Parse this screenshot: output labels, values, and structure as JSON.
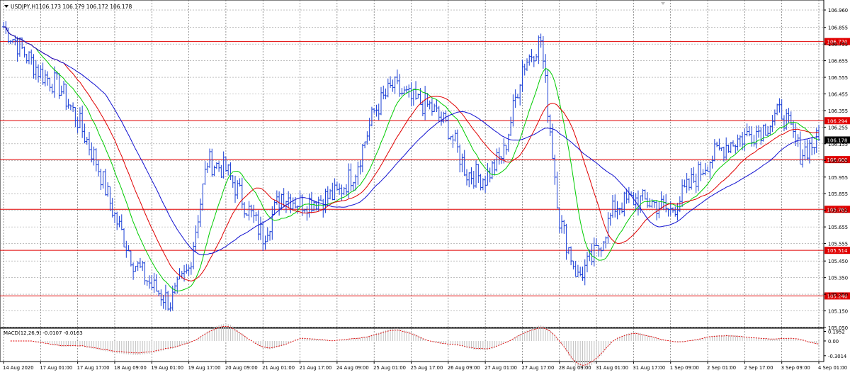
{
  "header": {
    "symbol_label": "USDJPY,H1",
    "ohlc": "106.173 106.179 106.172 106.178"
  },
  "colors": {
    "candles": "#1a3fd6",
    "ma_fast": "#00cc00",
    "ma_mid": "#e00000",
    "ma_slow": "#1010d0",
    "level_line": "#e00000",
    "grid": "#000000",
    "macd_hist": "#c0c0c0",
    "macd_signal": "#e00000"
  },
  "chart_data": [
    {
      "type": "candlestick",
      "title": "USDJPY,H1",
      "ylim": [
        105.05,
        107.02
      ],
      "y_ticks": [
        106.96,
        106.855,
        106.755,
        106.655,
        106.555,
        106.455,
        106.355,
        106.255,
        106.155,
        106.055,
        105.955,
        105.855,
        105.755,
        105.655,
        105.555,
        105.45,
        105.35,
        105.25,
        105.15,
        105.05
      ],
      "y_tick_labels": [
        "106.960",
        "106.855",
        "106.755",
        "106.655",
        "106.555",
        "106.455",
        "106.355",
        "106.255",
        "106.155",
        "106.055",
        "105.955",
        "105.855",
        "105.755",
        "105.655",
        "105.555",
        "105.450",
        "105.350",
        "105.250",
        "105.150",
        "105.050"
      ],
      "x_labels": [
        "14 Aug 2020",
        "17 Aug 01:00",
        "17 Aug 17:00",
        "18 Aug 09:00",
        "19 Aug 01:00",
        "19 Aug 17:00",
        "20 Aug 09:00",
        "21 Aug 01:00",
        "21 Aug 17:00",
        "24 Aug 09:00",
        "25 Aug 01:00",
        "25 Aug 17:00",
        "26 Aug 09:00",
        "27 Aug 01:00",
        "27 Aug 17:00",
        "28 Aug 09:00",
        "31 Aug 01:00",
        "31 Aug 17:00",
        "1 Sep 09:00",
        "2 Sep 01:00",
        "2 Sep 17:00",
        "3 Sep 09:00",
        "4 Sep 01:00"
      ],
      "x_label_positions": [
        0,
        2,
        4,
        6,
        8,
        10,
        12,
        14,
        16,
        18,
        20,
        22,
        24,
        26,
        28,
        30,
        32,
        34,
        36,
        38,
        40,
        42,
        44
      ],
      "x_count": 45,
      "grid": true,
      "levels": [
        {
          "value": 106.77,
          "label": "106.770"
        },
        {
          "value": 106.294,
          "label": "106.294"
        },
        {
          "value": 106.06,
          "label": "106.060"
        },
        {
          "value": 105.761,
          "label": "105.761"
        },
        {
          "value": 105.514,
          "label": "105.514"
        },
        {
          "value": 105.24,
          "label": "105.240"
        }
      ],
      "current_price": {
        "value": 106.178,
        "label": "106.178"
      },
      "price_path": [
        [
          0,
          106.86
        ],
        [
          1,
          106.72
        ],
        [
          2,
          106.58
        ],
        [
          3,
          106.5
        ],
        [
          4,
          106.3
        ],
        [
          5,
          106.05
        ],
        [
          6,
          105.72
        ],
        [
          7,
          105.45
        ],
        [
          8,
          105.3
        ],
        [
          9,
          105.2
        ],
        [
          10,
          105.4
        ],
        [
          11,
          106.05
        ],
        [
          12,
          106.0
        ],
        [
          13,
          105.8
        ],
        [
          14,
          105.6
        ],
        [
          15,
          105.85
        ],
        [
          16,
          105.8
        ],
        [
          17,
          105.82
        ],
        [
          18,
          105.85
        ],
        [
          19,
          106.0
        ],
        [
          20,
          106.35
        ],
        [
          21,
          106.5
        ],
        [
          22,
          106.42
        ],
        [
          23,
          106.38
        ],
        [
          24,
          106.25
        ],
        [
          25,
          105.98
        ],
        [
          26,
          105.95
        ],
        [
          27,
          106.1
        ],
        [
          28,
          106.62
        ],
        [
          29,
          106.78
        ],
        [
          30,
          105.7
        ],
        [
          31,
          105.35
        ],
        [
          32,
          105.5
        ],
        [
          33,
          105.78
        ],
        [
          34,
          105.82
        ],
        [
          35,
          105.8
        ],
        [
          36,
          105.75
        ],
        [
          37,
          105.9
        ],
        [
          38,
          106.05
        ],
        [
          39,
          106.15
        ],
        [
          40,
          106.2
        ],
        [
          41,
          106.25
        ],
        [
          42,
          106.35
        ],
        [
          43,
          106.1
        ],
        [
          44,
          106.18
        ]
      ],
      "candle_series": {
        "name": "USDJPY,H1",
        "start_index": 0,
        "end_index": 44,
        "bars_per_step": 8
      },
      "moving_averages": [
        {
          "key": "ma_fast",
          "smoothing": 14
        },
        {
          "key": "ma_mid",
          "smoothing": 26
        },
        {
          "key": "ma_slow",
          "smoothing": 44
        }
      ]
    },
    {
      "type": "histogram",
      "title": "MACD(12,26,9) -0.0107 -0.0163",
      "y_tick_labels": [
        "0.1952",
        "0.00",
        "-0.3014"
      ],
      "y_ticks": [
        0.1952,
        0.0,
        -0.3014
      ],
      "ylim": [
        -0.42,
        0.26
      ]
    }
  ]
}
